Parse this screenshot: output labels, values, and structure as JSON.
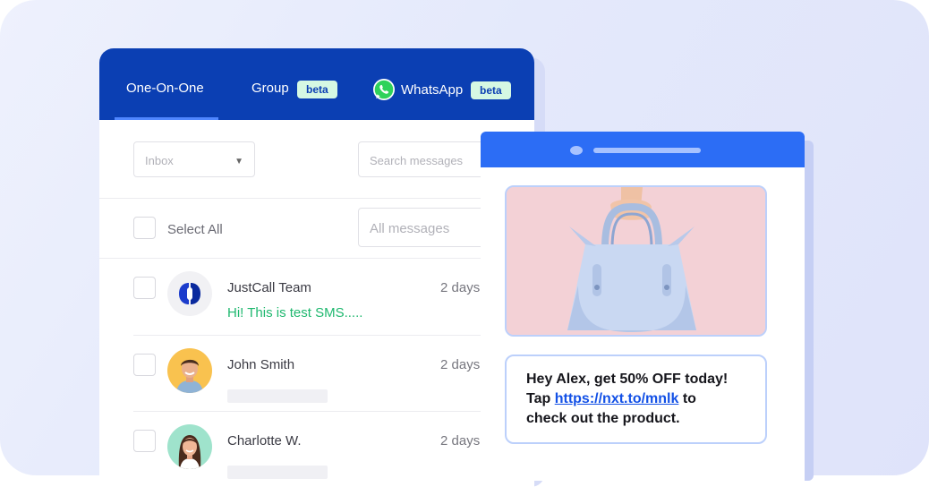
{
  "tabs": [
    {
      "label": "One-On-One",
      "active": true
    },
    {
      "label": "Group",
      "badge": "beta"
    },
    {
      "label": "WhatsApp",
      "badge": "beta",
      "icon": "whatsapp-icon"
    }
  ],
  "filters": {
    "inbox_select": "Inbox",
    "search_placeholder": "Search messages",
    "select_all_label": "Select All",
    "message_filter": "All messages"
  },
  "conversations": [
    {
      "name": "JustCall Team",
      "time": "2 days",
      "preview": "Hi! This is test SMS.....",
      "avatar": "justcall-logo-icon"
    },
    {
      "name": "John Smith",
      "time": "2 days",
      "avatar": "john-smith-avatar"
    },
    {
      "name": "Charlotte W.",
      "time": "2 days",
      "avatar": "charlotte-avatar"
    }
  ],
  "message": {
    "line1": "Hey Alex, get 50% OFF today!",
    "tap": "Tap",
    "link": "https://nxt.to/mnlk",
    "to": "to",
    "line3": "check out the product."
  },
  "colors": {
    "tab_bar": "#0b3fb3",
    "phone_bar": "#2c6df5",
    "badge_bg": "#d5f8e3",
    "preview_green": "#1fb86f",
    "link_blue": "#1250e6"
  }
}
